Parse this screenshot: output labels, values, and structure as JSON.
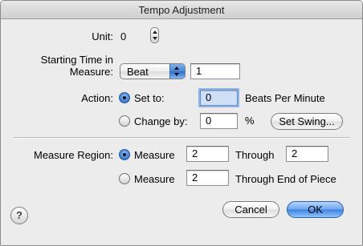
{
  "window": {
    "title": "Tempo Adjustment"
  },
  "unit": {
    "label": "Unit:",
    "value": "0"
  },
  "starting_time": {
    "label_line1": "Starting Time in",
    "label_line2": "Measure:",
    "popup_selected": "Beat",
    "value": "1"
  },
  "action": {
    "label": "Action:",
    "set_to": {
      "label": "Set to:",
      "value": "0",
      "unit_label": "Beats Per Minute",
      "selected": true
    },
    "change_by": {
      "label": "Change by:",
      "value": "0",
      "unit_label": "%",
      "selected": false
    },
    "set_swing_label": "Set Swing..."
  },
  "measure_region": {
    "label": "Measure Region:",
    "row1": {
      "label": "Measure",
      "from": "2",
      "through_label": "Through",
      "through": "2",
      "selected": true
    },
    "row2": {
      "label": "Measure",
      "from": "2",
      "through_label": "Through End of Piece",
      "selected": false
    }
  },
  "buttons": {
    "help": "?",
    "cancel": "Cancel",
    "ok": "OK"
  }
}
